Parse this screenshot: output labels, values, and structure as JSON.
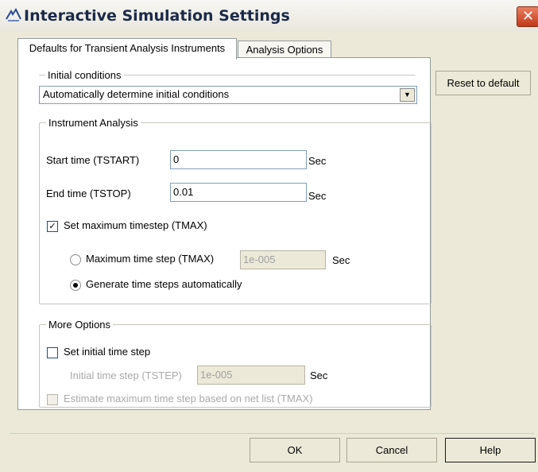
{
  "window": {
    "title": "Interactive Simulation Settings",
    "close_glyph": "✕"
  },
  "tabs": [
    {
      "label": "Defaults for Transient Analysis Instruments",
      "active": true
    },
    {
      "label": "Analysis Options",
      "active": false
    }
  ],
  "reset_button": "Reset to default",
  "initial_conditions": {
    "legend": "Initial conditions",
    "selected": "Automatically determine initial conditions"
  },
  "instrument_analysis": {
    "legend": "Instrument Analysis",
    "start_label": "Start time (TSTART)",
    "start_value": "0",
    "start_unit": "Sec",
    "end_label": "End time (TSTOP)",
    "end_value": "0.01",
    "end_unit": "Sec",
    "set_max_label": "Set maximum timestep (TMAX)",
    "set_max_checked": true,
    "max_step_label": "Maximum time step (TMAX)",
    "max_step_value": "1e-005",
    "max_step_unit": "Sec",
    "auto_label": "Generate time steps automatically",
    "selected_mode": "auto"
  },
  "more_options": {
    "legend": "More Options",
    "set_initial_label": "Set initial time step",
    "set_initial_checked": false,
    "tstep_label": "Initial time step (TSTEP)",
    "tstep_value": "1e-005",
    "tstep_unit": "Sec",
    "estimate_label": "Estimate maximum time step based on net list (TMAX)",
    "estimate_checked": false
  },
  "footer": {
    "ok": "OK",
    "cancel": "Cancel",
    "help": "Help"
  },
  "colors": {
    "accent": "#1c5180",
    "close": "#c2381a",
    "face": "#ece9d8"
  },
  "icons": {
    "app": "simulation-app-icon",
    "close": "close-icon",
    "dropdown": "chevron-down-icon",
    "check": "checkmark-icon"
  }
}
